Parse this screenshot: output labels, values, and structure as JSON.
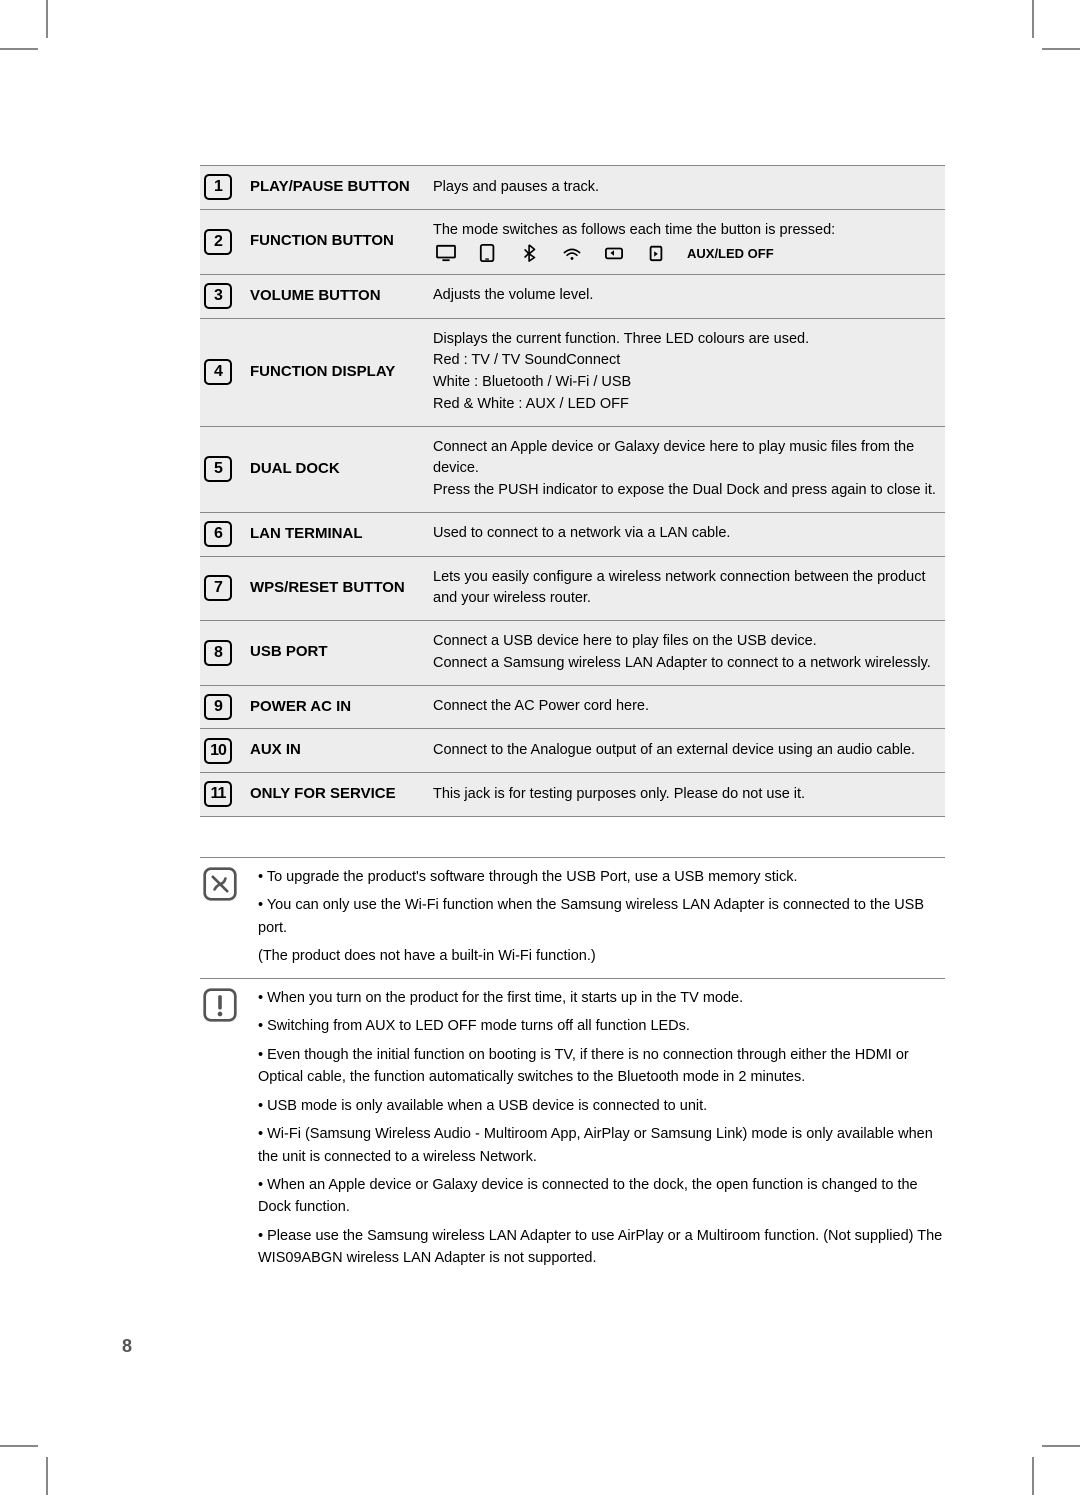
{
  "page_number": "8",
  "rows": [
    {
      "num": "1",
      "label": "PLAY/PAUSE BUTTON",
      "desc": [
        "Plays and pauses a track."
      ]
    },
    {
      "num": "2",
      "label": "FUNCTION BUTTON",
      "desc": [
        "The mode switches as follows each time the button is pressed:"
      ],
      "icons": true,
      "aux_label": "AUX/LED OFF"
    },
    {
      "num": "3",
      "label": "VOLUME BUTTON",
      "desc": [
        "Adjusts the volume level."
      ]
    },
    {
      "num": "4",
      "label": "FUNCTION DISPLAY",
      "desc": [
        "Displays the current function. Three LED colours are used.",
        "Red : TV / TV SoundConnect",
        "White : Bluetooth / Wi-Fi / USB",
        "Red & White : AUX / LED OFF"
      ]
    },
    {
      "num": "5",
      "label": "DUAL DOCK",
      "desc": [
        "Connect an Apple device or Galaxy device here to play music files from the device.",
        "Press the PUSH indicator to expose the Dual Dock and press again to close it."
      ]
    },
    {
      "num": "6",
      "label": "LAN TERMINAL",
      "desc": [
        "Used to connect to a network via a LAN cable."
      ]
    },
    {
      "num": "7",
      "label": "WPS/RESET BUTTON",
      "desc": [
        "Lets you easily configure a wireless network connection between the product and your wireless router."
      ]
    },
    {
      "num": "8",
      "label": "USB PORT",
      "desc": [
        "Connect a USB device here to play files on the USB device.",
        "Connect a Samsung wireless LAN Adapter to connect to a network wirelessly."
      ]
    },
    {
      "num": "9",
      "label": "POWER AC IN",
      "desc": [
        "Connect the AC Power cord here."
      ]
    },
    {
      "num": "10",
      "label": "AUX IN",
      "desc": [
        "Connect to the Analogue output of an external device using an audio cable."
      ]
    },
    {
      "num": "11",
      "label": "ONLY FOR SERVICE",
      "desc": [
        "This jack is for testing purposes only. Please do not use it."
      ]
    }
  ],
  "note1": {
    "lines": [
      "To upgrade the product's software through the USB Port, use a USB memory stick.",
      "You can only use the Wi-Fi function when the Samsung wireless LAN Adapter is connected to the USB port.",
      "(The product does not have a built-in Wi-Fi function.)"
    ]
  },
  "note2": {
    "lines": [
      "When you turn on the product for the first time, it starts up in the TV mode.",
      "Switching from AUX to LED OFF mode turns off all function LEDs.",
      "Even though the initial function on booting is TV, if there is no connection through either the HDMI or Optical cable, the function automatically switches to the Bluetooth mode in 2 minutes.",
      "USB mode is only available when a USB device is connected to unit.",
      "Wi-Fi (Samsung Wireless Audio - Multiroom App, AirPlay or Samsung Link) mode is only available when the unit is connected to a wireless Network.",
      "When an Apple device or Galaxy device is connected to the dock, the open function is changed to the Dock function.",
      "Please use the Samsung wireless LAN Adapter to use AirPlay or a Multiroom function. (Not supplied) The WIS09ABGN wireless LAN Adapter is not supported."
    ]
  }
}
